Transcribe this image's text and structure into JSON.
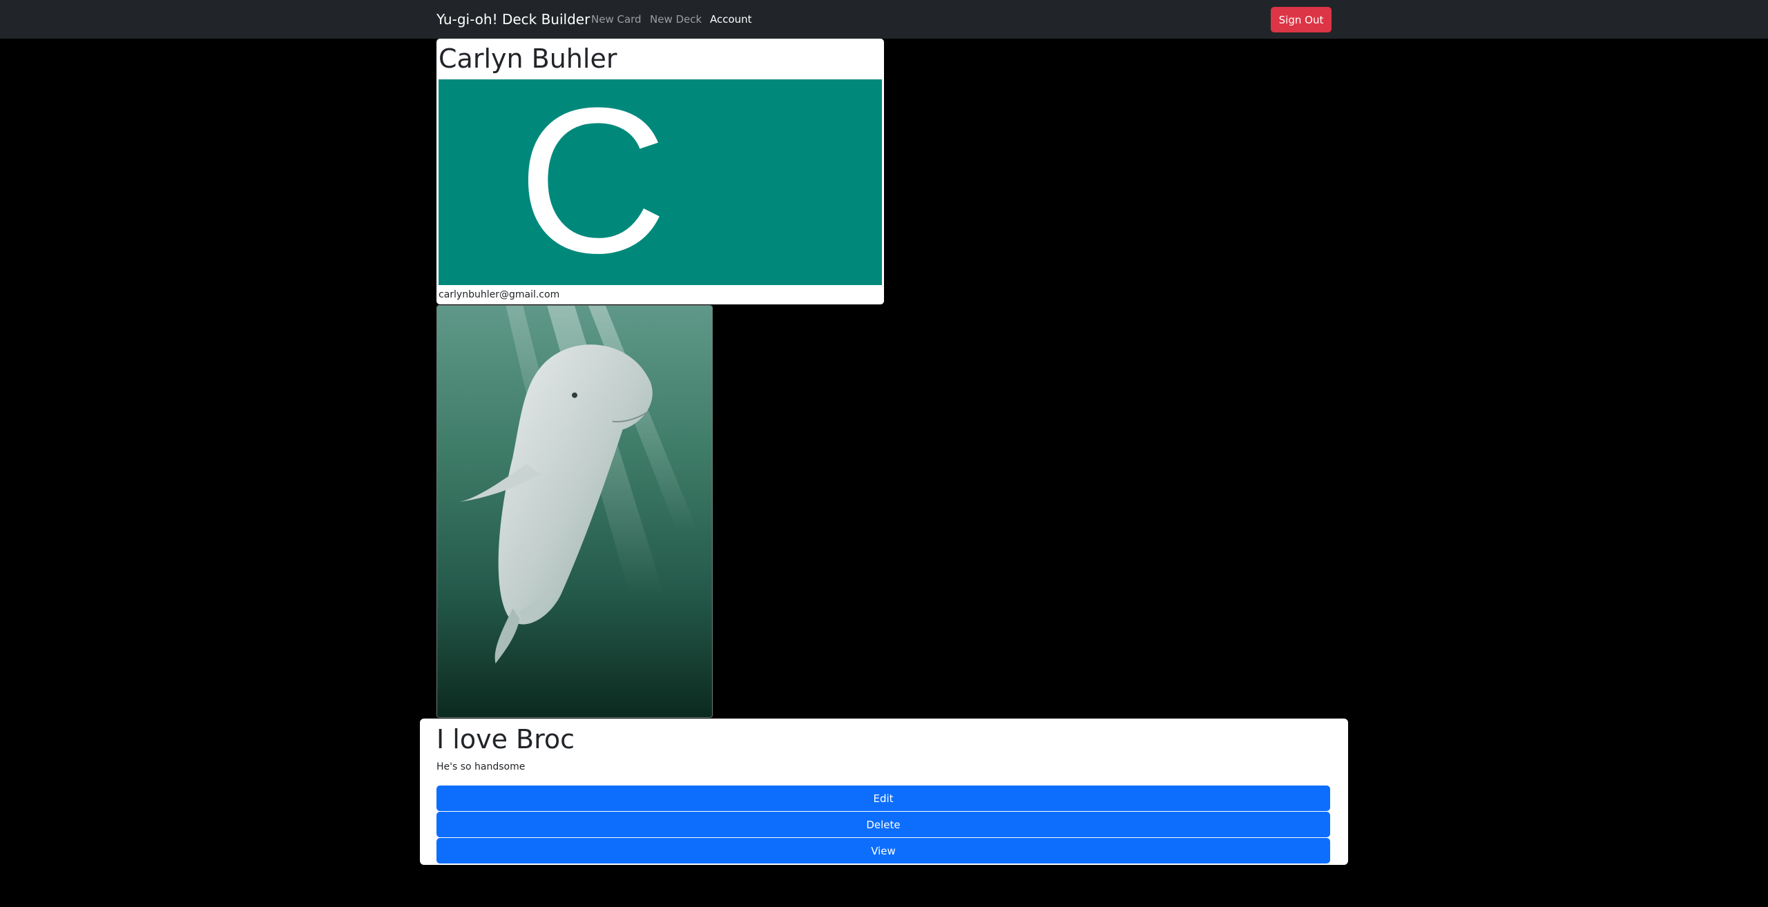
{
  "navbar": {
    "brand": "Yu-gi-oh! Deck Builder",
    "links": [
      "New Card",
      "New Deck",
      "Account"
    ],
    "sign_out_label": "Sign Out"
  },
  "profile": {
    "name": "Carlyn Buhler",
    "avatar_letter": "C",
    "avatar_color": "#00897b",
    "email": "carlynbuhler@gmail.com"
  },
  "deck": {
    "image_subject": "beluga-whale-photo",
    "title": "I love Broc",
    "description": "He's so handsome",
    "buttons": {
      "edit": "Edit",
      "delete": "Delete",
      "view": "View"
    }
  },
  "colors": {
    "navbar_bg": "#212529",
    "sign_out": "#dc3545",
    "primary": "#0d6efd",
    "page_bg": "#000000"
  }
}
